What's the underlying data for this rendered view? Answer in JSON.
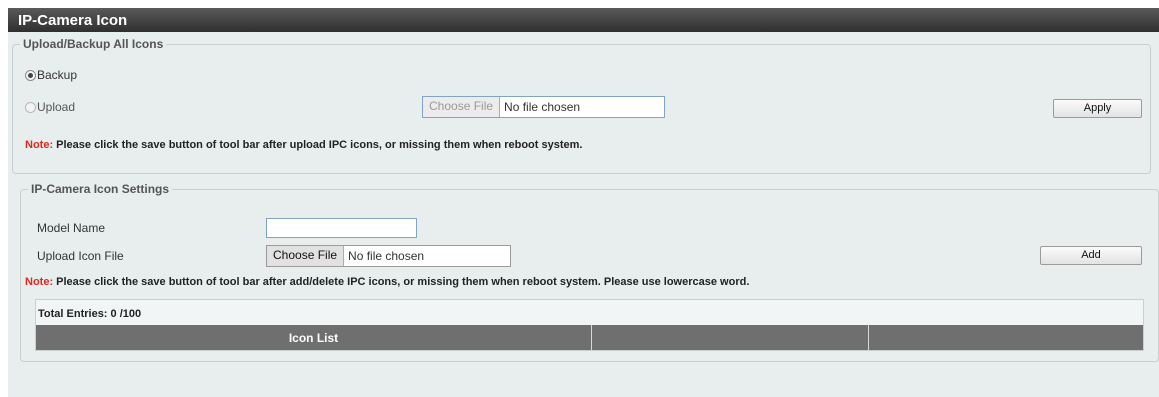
{
  "page_title": "IP-Camera Icon",
  "upload_backup": {
    "legend": "Upload/Backup All Icons",
    "backup_label": "Backup",
    "upload_label": "Upload",
    "selected": "Backup",
    "file_button": "Choose File",
    "file_status": "No file chosen",
    "apply_label": "Apply",
    "note_prefix": "Note:",
    "note_text": " Please click the save button of tool bar after upload IPC icons, or missing them when reboot system."
  },
  "icon_settings": {
    "legend": "IP-Camera Icon Settings",
    "model_name_label": "Model Name",
    "model_name_value": "",
    "upload_icon_label": "Upload Icon File",
    "file_button": "Choose File",
    "file_status": "No file chosen",
    "add_label": "Add",
    "note_prefix": "Note:",
    "note_text": " Please click the save button of tool bar after add/delete IPC icons, or missing them when reboot system. Please use lowercase word.",
    "total_entries": "Total Entries: 0 /100",
    "table_headers": [
      "Icon List",
      "",
      ""
    ]
  },
  "colors": {
    "note_red": "#e0281f",
    "title_bar": "#3e3e3e",
    "table_header": "#6f6f6f",
    "panel_bg": "#e8eeed"
  }
}
